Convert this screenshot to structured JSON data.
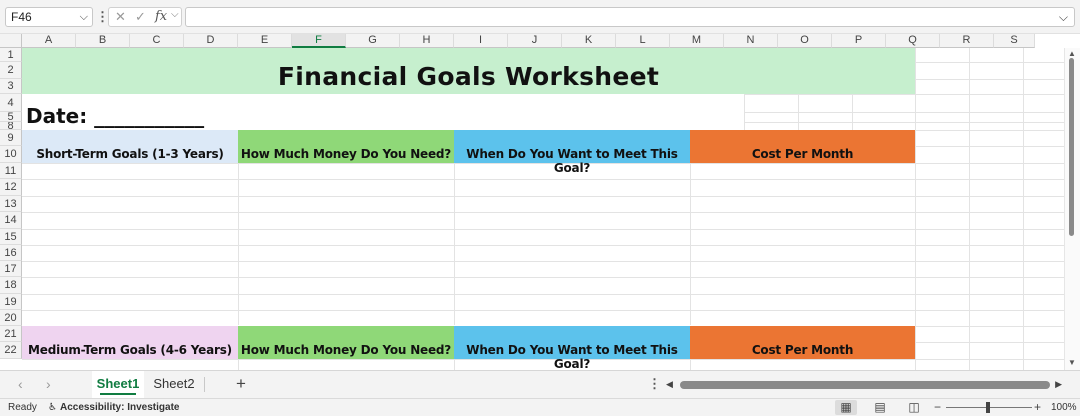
{
  "formula_bar": {
    "name_box": "F46",
    "cancel_icon": "✕",
    "enter_icon": "✓",
    "fx_label": "fx",
    "formula": ""
  },
  "columns": [
    {
      "id": "A",
      "w": 54
    },
    {
      "id": "B",
      "w": 54
    },
    {
      "id": "C",
      "w": 54
    },
    {
      "id": "D",
      "w": 54
    },
    {
      "id": "E",
      "w": 54
    },
    {
      "id": "F",
      "w": 54
    },
    {
      "id": "G",
      "w": 54
    },
    {
      "id": "H",
      "w": 54
    },
    {
      "id": "I",
      "w": 54
    },
    {
      "id": "J",
      "w": 54
    },
    {
      "id": "K",
      "w": 54
    },
    {
      "id": "L",
      "w": 54
    },
    {
      "id": "M",
      "w": 54
    },
    {
      "id": "N",
      "w": 54
    },
    {
      "id": "O",
      "w": 54
    },
    {
      "id": "P",
      "w": 54
    },
    {
      "id": "Q",
      "w": 54
    },
    {
      "id": "R",
      "w": 54
    },
    {
      "id": "S",
      "w": 54
    }
  ],
  "selected_column": "F",
  "rows": [
    "1",
    "2",
    "3",
    "4",
    "5",
    "8",
    "9",
    "10",
    "11",
    "12",
    "13",
    "14",
    "15",
    "16",
    "17",
    "18",
    "19",
    "20",
    "21",
    "22"
  ],
  "sheet": {
    "title": "Financial Goals Worksheet",
    "date_label": "Date: ___________",
    "short_term": {
      "goal_header": "Short-Term Goals (1-3 Years)",
      "money_header": "How Much Money Do You Need?",
      "when_header": "When Do You Want to Meet This Goal?",
      "cost_header": "Cost Per Month"
    },
    "medium_term": {
      "goal_header": "Medium-Term Goals (4-6 Years)",
      "money_header": "How Much Money Do You Need?",
      "when_header": "When Do You Want to Meet This Goal?",
      "cost_header": "Cost Per Month"
    }
  },
  "colors": {
    "title_fill": "#c6efce",
    "short_term_fill": "#dce9f7",
    "medium_term_fill": "#efd4f0",
    "money_fill": "#8fd878",
    "when_fill": "#5cc2ec",
    "cost_fill": "#eb7533",
    "accent": "#107c41"
  },
  "tabs": [
    {
      "label": "Sheet1",
      "active": true
    },
    {
      "label": "Sheet2",
      "active": false
    }
  ],
  "status": {
    "ready": "Ready",
    "accessibility": "Accessibility: Investigate",
    "zoom": "100%"
  }
}
